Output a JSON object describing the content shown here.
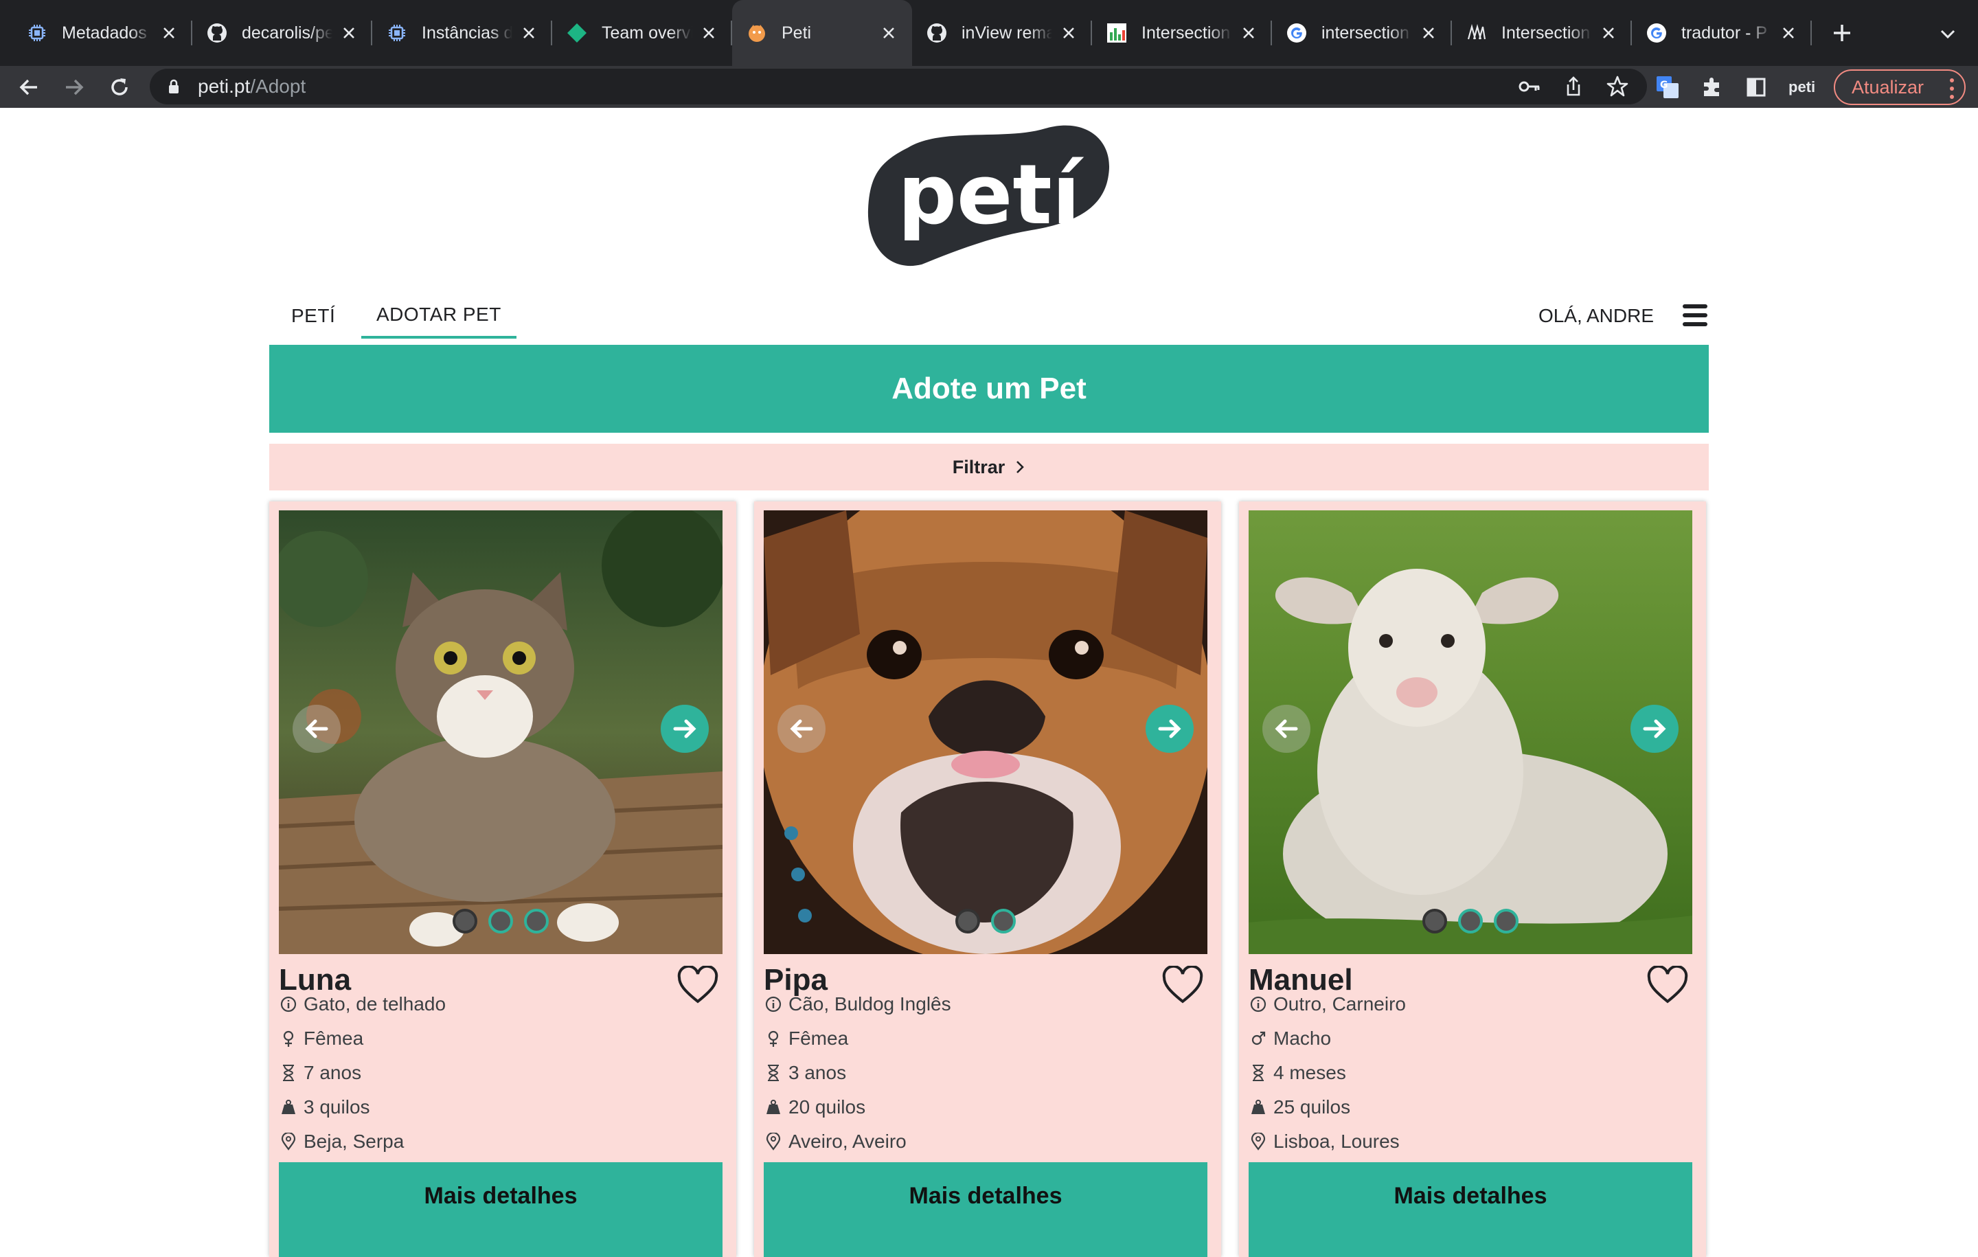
{
  "browser": {
    "tabs": [
      {
        "title": "Metadados",
        "icon": "chip-icon"
      },
      {
        "title": "decarolis/peti",
        "icon": "github-icon"
      },
      {
        "title": "Instâncias do",
        "icon": "chip-icon"
      },
      {
        "title": "Team overview",
        "icon": "diamond-icon"
      },
      {
        "title": "Peti",
        "icon": "peti-icon",
        "active": true
      },
      {
        "title": "inView remains",
        "icon": "github-icon"
      },
      {
        "title": "Intersection",
        "icon": "chart-icon"
      },
      {
        "title": "intersection",
        "icon": "google-icon"
      },
      {
        "title": "Intersection",
        "icon": "medium-icon"
      },
      {
        "title": "tradutor - P",
        "icon": "google-icon"
      }
    ],
    "url_host": "peti.pt",
    "url_path": "/Adopt",
    "profile_label": "peti",
    "update_label": "Atualizar"
  },
  "site": {
    "logo_text": "petí",
    "nav": [
      {
        "label": "PETÍ"
      },
      {
        "label": "ADOTAR PET",
        "active": true
      }
    ],
    "greeting": "OLÁ, ANDRE"
  },
  "banner": {
    "title": "Adote um Pet"
  },
  "filter": {
    "label": "Filtrar"
  },
  "pets": [
    {
      "name": "Luna",
      "type": "Gato, de telhado",
      "sex": "Fêmea",
      "sex_icon": "female-icon",
      "age": "7 anos",
      "weight": "3 quilos",
      "location": "Beja, Serpa",
      "photos": 3,
      "button": "Mais detalhes"
    },
    {
      "name": "Pipa",
      "type": "Cão, Buldog Inglês",
      "sex": "Fêmea",
      "sex_icon": "female-icon",
      "age": "3 anos",
      "weight": "20 quilos",
      "location": "Aveiro, Aveiro",
      "photos": 2,
      "button": "Mais detalhes"
    },
    {
      "name": "Manuel",
      "type": "Outro, Carneiro",
      "sex": "Macho",
      "sex_icon": "male-icon",
      "age": "4 meses",
      "weight": "25 quilos",
      "location": "Lisboa, Loures",
      "photos": 3,
      "button": "Mais detalhes"
    }
  ]
}
